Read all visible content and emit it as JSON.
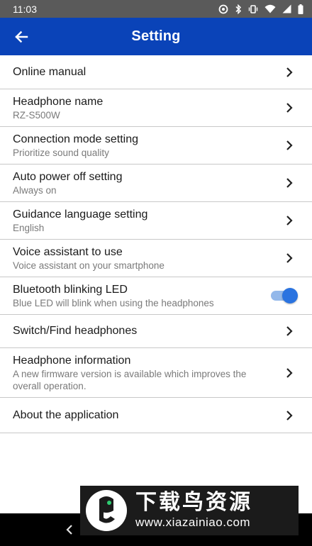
{
  "status_bar": {
    "time": "11:03",
    "icons": [
      "sync-icon",
      "bluetooth-icon",
      "vibrate-icon",
      "wifi-icon",
      "signal-icon",
      "battery-icon"
    ]
  },
  "app_bar": {
    "title": "Setting",
    "back_icon": "arrow-left-icon",
    "color": "#0a43b8"
  },
  "settings": {
    "online_manual": {
      "title": "Online manual"
    },
    "headphone_name": {
      "title": "Headphone name",
      "subtitle": "RZ-S500W"
    },
    "connection_mode": {
      "title": "Connection mode setting",
      "subtitle": "Prioritize sound quality"
    },
    "auto_power_off": {
      "title": "Auto power off setting",
      "subtitle": "Always on"
    },
    "guidance_language": {
      "title": "Guidance language setting",
      "subtitle": "English"
    },
    "voice_assistant": {
      "title": "Voice assistant to use",
      "subtitle": "Voice assistant on your smartphone"
    },
    "bluetooth_led": {
      "title": "Bluetooth blinking LED",
      "subtitle": "Blue LED will blink when using the headphones",
      "enabled": true
    },
    "switch_find": {
      "title": "Switch/Find headphones"
    },
    "headphone_info": {
      "title": "Headphone information",
      "subtitle": "A new firmware version is available which improves the overall operation."
    },
    "about_app": {
      "title": "About the application"
    }
  },
  "watermark": {
    "chinese": "下载鸟资源",
    "url": "www.xiazainiao.com"
  }
}
